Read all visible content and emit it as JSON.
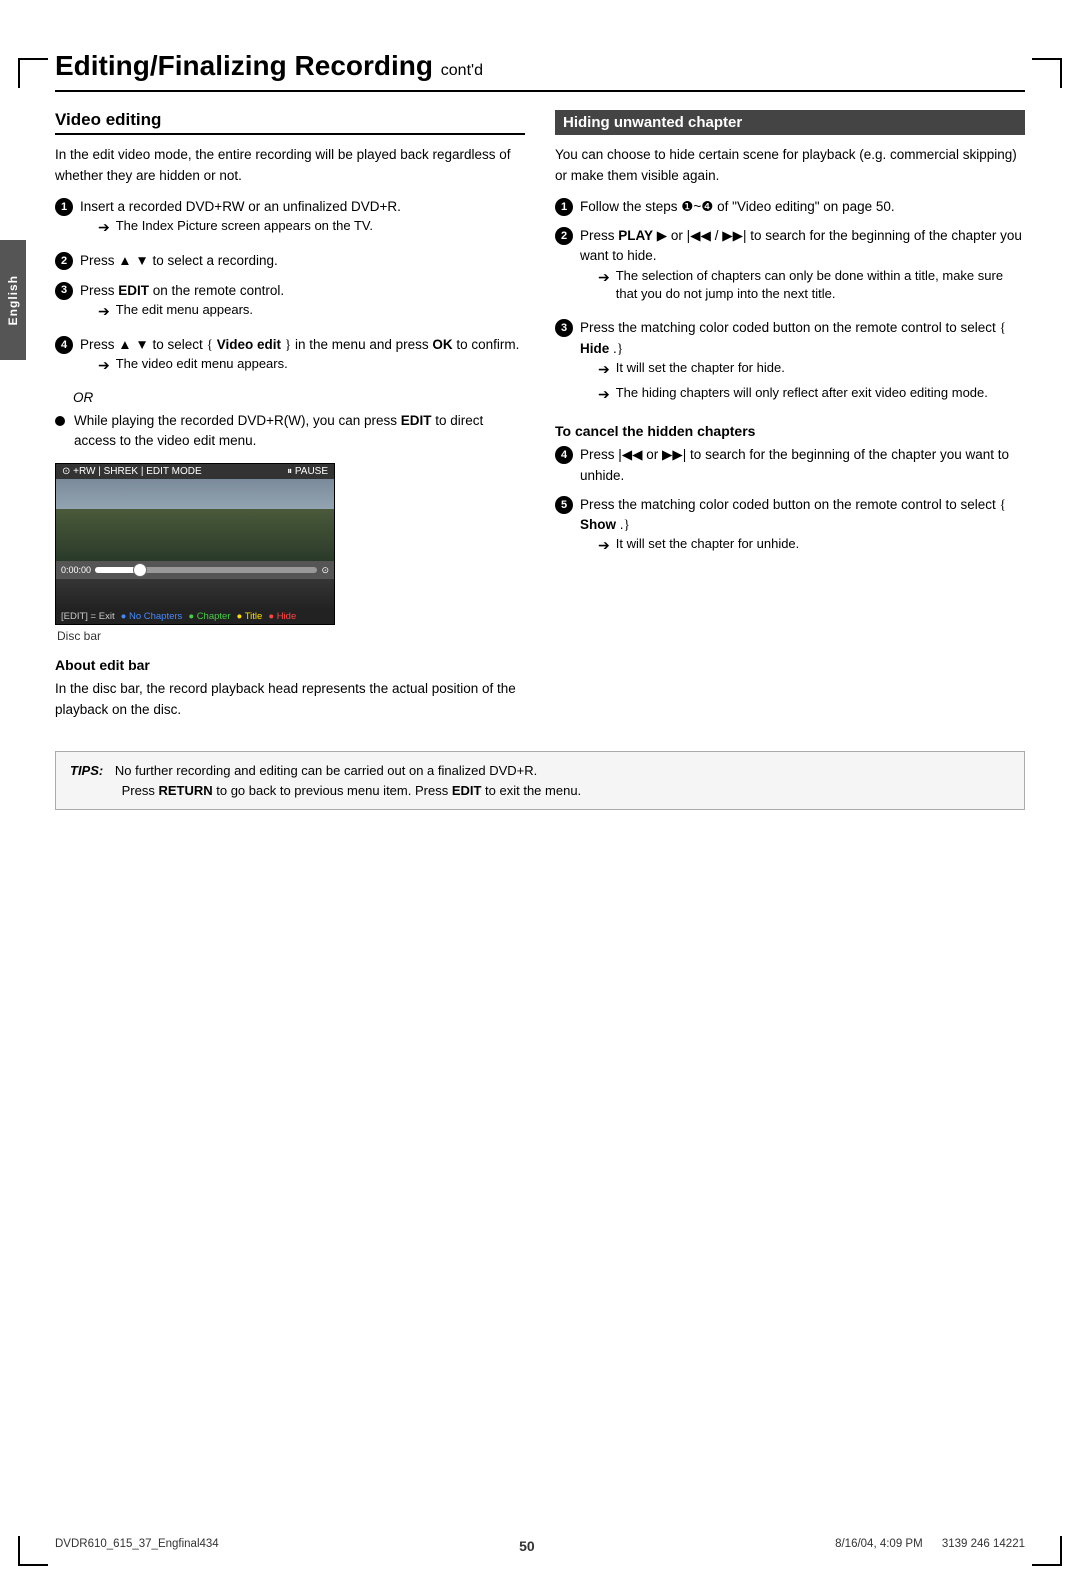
{
  "page": {
    "title": "Editing/Finalizing Recording",
    "title_contd": "cont'd",
    "side_tab": "English",
    "page_number": "50",
    "footer_left": "DVDR610_615_37_Engfinal434",
    "footer_center": "50",
    "footer_right_date": "8/16/04, 4:09 PM",
    "footer_far_right": "3139 246 14221"
  },
  "left_col": {
    "section_title": "Video editing",
    "intro_text": "In the edit video mode, the entire recording will be played back regardless of whether they are hidden or not.",
    "steps": [
      {
        "num": "1",
        "filled": true,
        "text": "Insert a recorded DVD+RW or an unfinalized DVD+R.",
        "arrow": "The Index Picture screen appears on the TV."
      },
      {
        "num": "2",
        "filled": true,
        "text": "Press ▲ ▼ to select a recording.",
        "arrow": null
      },
      {
        "num": "3",
        "filled": true,
        "text": "Press EDIT on the remote control.",
        "arrow": "The edit menu appears."
      },
      {
        "num": "4",
        "filled": true,
        "text": "Press ▲ ▼ to select { Video edit } in the menu and press OK to confirm.",
        "arrow": "The video edit menu appears."
      }
    ],
    "or_text": "OR",
    "bullet_text": "While playing the recorded DVD+R(W), you can press EDIT to direct access to the video edit menu.",
    "screenshot_top_left": "⊙ +RW | SHREK | EDIT MODE",
    "screenshot_top_right": "⏸ PAUSE",
    "screenshot_bottom_items": [
      {
        "dot": "●",
        "dot_color": "yellow",
        "label": "[EDIT] = Exit"
      },
      {
        "dot": "●",
        "dot_color": "blue",
        "label": "No Chapters"
      },
      {
        "dot": "●",
        "dot_color": "green",
        "label": "Chapter"
      },
      {
        "dot": "●",
        "dot_color": "red",
        "label": "Title"
      },
      {
        "dot": "●",
        "dot_color": "white",
        "label": "Hide"
      }
    ],
    "disc_bar_label": "Disc bar",
    "sub_heading": "About edit bar",
    "about_edit_bar": "In the disc bar, the record playback head represents the actual position of the playback on the disc."
  },
  "right_col": {
    "section_title": "Hiding unwanted chapter",
    "intro_text": "You can choose to hide certain scene for playback (e.g. commercial skipping) or make them visible again.",
    "steps": [
      {
        "num": "1",
        "filled": true,
        "text": "Follow the steps ❶~❹ of \"Video editing\" on page 50."
      },
      {
        "num": "2",
        "filled": true,
        "text": "Press PLAY ▶ or |◀◀ / ▶▶| to search for the beginning of the chapter you want to hide.",
        "arrow1": "The selection of chapters can only be done within a title, make sure that you do not jump into the next title."
      },
      {
        "num": "3",
        "filled": true,
        "text": "Press the matching color coded button on the remote control to select { Hide .}",
        "arrow1": "It will set the chapter for hide.",
        "arrow2": "The hiding chapters will only reflect after exit video editing mode."
      }
    ],
    "cancel_heading": "To cancel the hidden chapters",
    "cancel_steps": [
      {
        "num": "4",
        "filled": true,
        "text": "Press |◀◀ or ▶▶| to search for the beginning of the chapter you want to unhide."
      },
      {
        "num": "5",
        "filled": true,
        "text": "Press the matching color coded button on the remote control to select { Show .}",
        "arrow": "It will set the chapter for unhide."
      }
    ]
  },
  "tips": {
    "label": "TIPS:",
    "line1": "No further recording and editing can be carried out on a finalized DVD+R.",
    "line2": "Press RETURN to go back to previous menu item.  Press EDIT to exit the menu."
  }
}
